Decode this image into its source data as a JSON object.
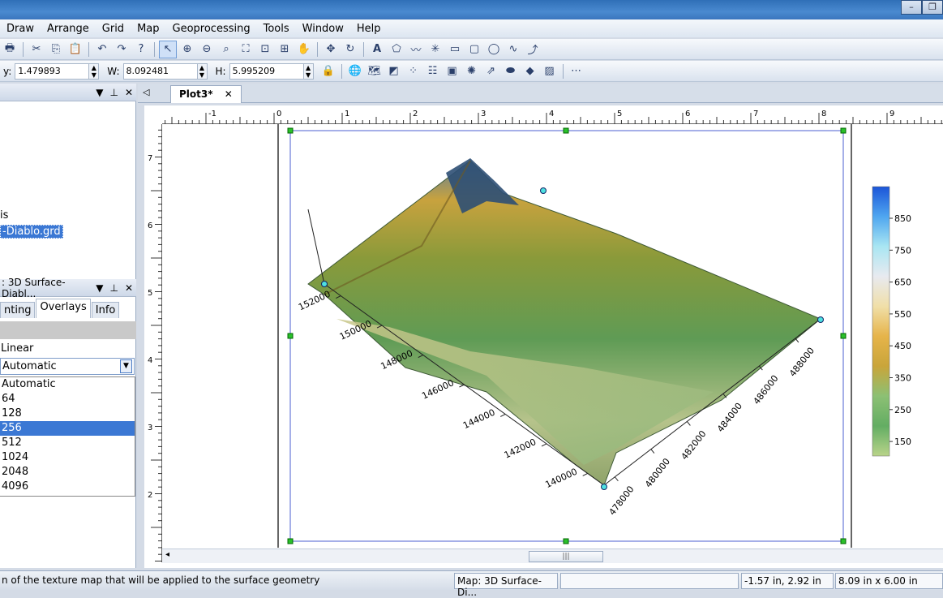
{
  "menu": [
    "Draw",
    "Arrange",
    "Grid",
    "Map",
    "Geoprocessing",
    "Tools",
    "Window",
    "Help"
  ],
  "props": {
    "y_label": "y:",
    "y_value": "1.479893",
    "w_label": "W:",
    "w_value": "8.092481",
    "h_label": "H:",
    "h_value": "5.995209"
  },
  "left_panel": {
    "tree_text1": "is",
    "tree_selected": "-Diablo.grd",
    "props_title": ": 3D Surface-Diabl...",
    "tabs": [
      "nting",
      "Overlays",
      "Info"
    ],
    "linear_label": "Linear",
    "combo_value": "Automatic",
    "options": [
      "Automatic",
      "64",
      "128",
      "256",
      "512",
      "1024",
      "2048",
      "4096"
    ],
    "selected_option": "256"
  },
  "doc_tab": "Plot3*",
  "ruler_h": [
    "-1",
    "0",
    "1",
    "2",
    "3",
    "4",
    "5",
    "6",
    "7",
    "8",
    "9"
  ],
  "ruler_v": [
    "7",
    "6",
    "5",
    "4",
    "3",
    "2"
  ],
  "plot": {
    "y_ticks": [
      "152000",
      "150000",
      "148000",
      "146000",
      "144000",
      "142000",
      "140000"
    ],
    "x_ticks": [
      "478000",
      "480000",
      "482000",
      "484000",
      "486000",
      "488000"
    ],
    "colorbar_ticks": [
      "850",
      "750",
      "650",
      "550",
      "450",
      "350",
      "250",
      "150"
    ],
    "colorbar_colors": [
      "#1b55d8",
      "#4fa6f0",
      "#a9e6f2",
      "#e8eaf0",
      "#f0dfa8",
      "#e6b44a",
      "#c9a53a",
      "#8cc074",
      "#63ad63",
      "#b9d48a"
    ]
  },
  "status": {
    "message": "n of the texture map that will be applied to the surface geometry",
    "map": "Map: 3D Surface-Di...",
    "coords": "-1.57 in, 2.92 in",
    "size": "8.09 in x 6.00 in"
  }
}
